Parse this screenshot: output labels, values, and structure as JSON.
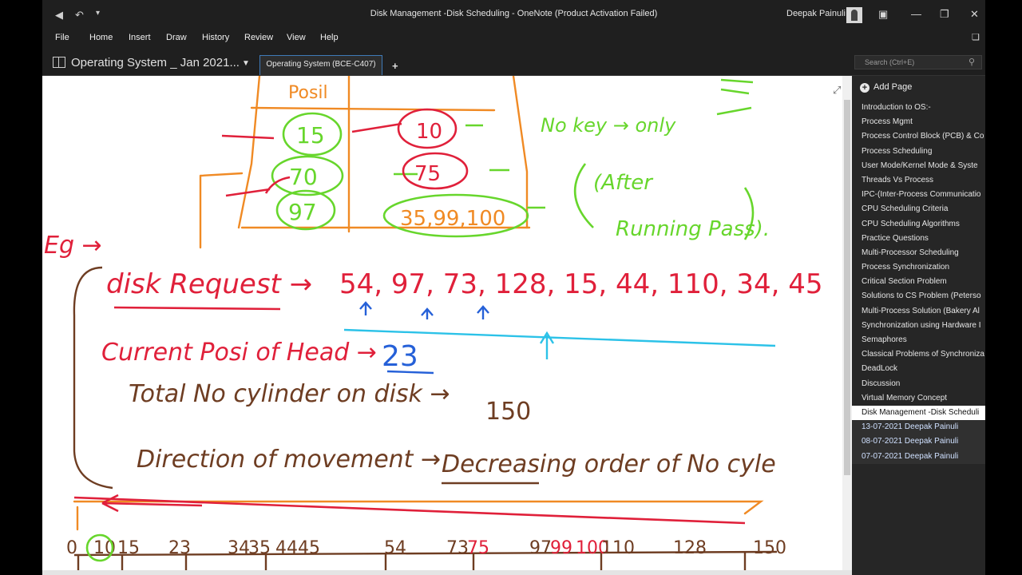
{
  "window": {
    "title": "Disk Management -Disk Scheduling  -  OneNote (Product Activation Failed)",
    "user": "Deepak Painuli"
  },
  "menu": [
    "File",
    "Home",
    "Insert",
    "Draw",
    "History",
    "Review",
    "View",
    "Help"
  ],
  "notebook": {
    "name": "Operating System _ Jan 2021...",
    "section_tab": "Operating System (BCE-C407)"
  },
  "search": {
    "placeholder": "Search (Ctrl+E)"
  },
  "pages_panel": {
    "add_page": "Add Page",
    "pages": [
      "Introduction to OS:-",
      "Process Mgmt",
      "Process Control Block (PCB) & Co",
      "Process Scheduling",
      "User Mode/Kernel Mode & Syste",
      "Threads Vs Process",
      "IPC-(Inter-Process Communicatio",
      "CPU Scheduling Criteria",
      "CPU Scheduling Algorithms",
      "Practice Questions",
      "Multi-Processor Scheduling",
      "Process Synchronization",
      "Critical Section Problem",
      "Solutions to CS Problem (Peterso",
      "Multi-Process Solution (Bakery Al",
      "Synchronization using Hardware I",
      "Semaphores",
      "Classical Problems of Synchroniza",
      "DeadLock",
      "Discussion",
      "Virtual Memory Concept",
      "Disk Management -Disk Scheduli",
      "13-07-2021 Deepak Painuli",
      "08-07-2021 Deepak Painuli",
      "07-07-2021 Deepak Painuli"
    ],
    "active_index": 21
  },
  "ink": {
    "table_header": "Posil",
    "left_col": [
      "15",
      "70",
      "97"
    ],
    "right_col": [
      "10",
      "75",
      "35,99,100"
    ],
    "green_note_1": "No key → only",
    "green_note_2": "(After",
    "green_note_3": "Running Pass).",
    "eg": "Eg →",
    "disk_request_label": "disk Request →",
    "disk_request_values": "54, 97, 73, 128, 15, 44, 110, 34, 45",
    "current_head_label": "Current Posi of Head →",
    "current_head_value": "23",
    "total_cyl_label": "Total No cylinder on disk →",
    "total_cyl_value": "150",
    "direction_label": "Direction of movement →",
    "direction_value": "Decreasing order of No cyle",
    "axis_labels": [
      "0",
      "10",
      "15",
      "23",
      "34",
      "35",
      "44",
      "45",
      "54",
      "73",
      "75",
      "97",
      "99",
      "100",
      "110",
      "128",
      "150"
    ]
  }
}
